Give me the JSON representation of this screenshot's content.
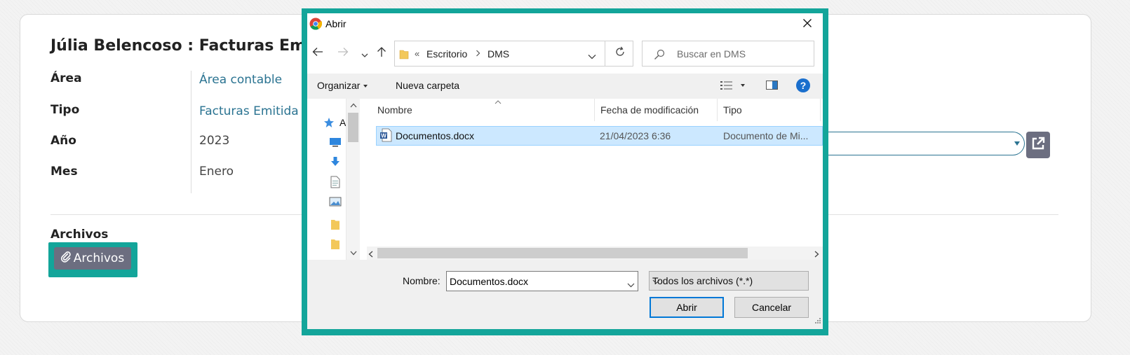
{
  "record": {
    "title": "Júlia Belencoso : Facturas Emiti",
    "fields": [
      {
        "label": "Área",
        "value": "Área contable"
      },
      {
        "label": "Tipo",
        "value": "Facturas Emitida"
      },
      {
        "label": "Año",
        "value": "2023"
      },
      {
        "label": "Mes",
        "value": "Enero"
      }
    ],
    "archivos_label": "Archivos",
    "archivos_button": "Archivos"
  },
  "dialog": {
    "title": "Abrir",
    "address": {
      "overflow": "«",
      "parts": [
        "Escritorio",
        "DMS"
      ]
    },
    "search_placeholder": "Buscar en DMS",
    "toolbar": {
      "organize": "Organizar",
      "new_folder": "Nueva carpeta"
    },
    "nav_pane": {
      "quick_access_label": "A"
    },
    "columns": [
      "Nombre",
      "Fecha de modificación",
      "Tipo"
    ],
    "files": [
      {
        "name": "Documentos.docx",
        "modified": "21/04/2023 6:36",
        "type": "Documento de Mi...",
        "icon": "word-document-icon"
      }
    ],
    "filename_label": "Nombre:",
    "filename_value": "Documentos.docx",
    "filter": "Todos los archivos (*.*)",
    "open_button": "Abrir",
    "cancel_button": "Cancelar"
  },
  "colors": {
    "highlight": "#13a59a",
    "link": "#2a7391",
    "button_gray": "#6c6e80",
    "selection": "#cce8ff",
    "accent_blue": "#0078d7"
  }
}
